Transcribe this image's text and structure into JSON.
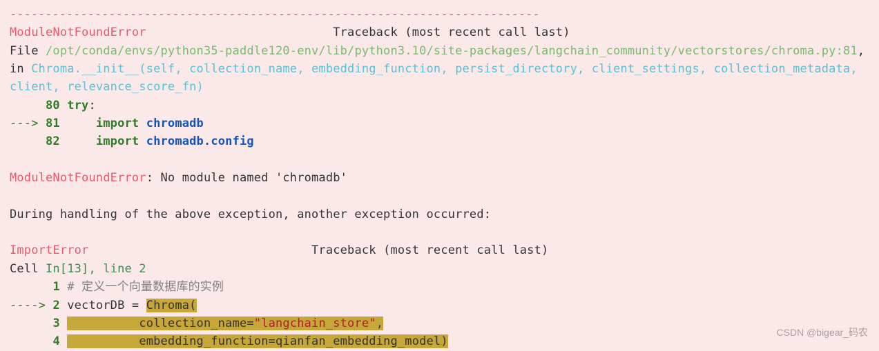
{
  "sep": "---------------------------------------------------------------------------",
  "err1": {
    "type": "ModuleNotFoundError",
    "trace_label": "Traceback (most recent call last)",
    "file_prefix": "File ",
    "file_path": "/opt/conda/envs/python35-paddle120-env/lib/python3.10/site-packages/langchain_community/vectorstores/chroma.py:81",
    "in": ", in ",
    "func_sig": "Chroma.__init__(self, collection_name, embedding_function, persist_directory, client_settings, collection_metadata, client, relevance_score_fn)",
    "lines": {
      "l80_no": "80",
      "l80_try": "try",
      "l80_colon": ":",
      "arrow81": "---> ",
      "l81_no": "81",
      "l81_kw": "import",
      "l81_mod": "chromadb",
      "l82_no": "82",
      "l82_kw": "import",
      "l82_mod": "chromadb.config"
    },
    "msg_prefix": "ModuleNotFoundError",
    "msg_rest": ": No module named 'chromadb'"
  },
  "during": "During handling of the above exception, another exception occurred:",
  "err2": {
    "type": "ImportError",
    "trace_label": "Traceback (most recent call last)",
    "cell_prefix": "Cell ",
    "cell_ref": "In[13], line 2",
    "lines": {
      "l1_no": "1",
      "l1_comment": "# 定义一个向量数据库的实例",
      "arrow2": "----> ",
      "l2_no": "2",
      "l2_code_a": "vectorDB = ",
      "l2_code_b": "Chroma(",
      "l3_no": "3",
      "l3_pad": "          ",
      "l3_a": "collection_name=",
      "l3_str": "\"langchain_store\"",
      "l3_c": ",",
      "l4_no": "4",
      "l4_pad": "          ",
      "l4_a": "embedding_function=qianfan_embedding_model)"
    }
  },
  "watermark": "CSDN @bigear_码农"
}
